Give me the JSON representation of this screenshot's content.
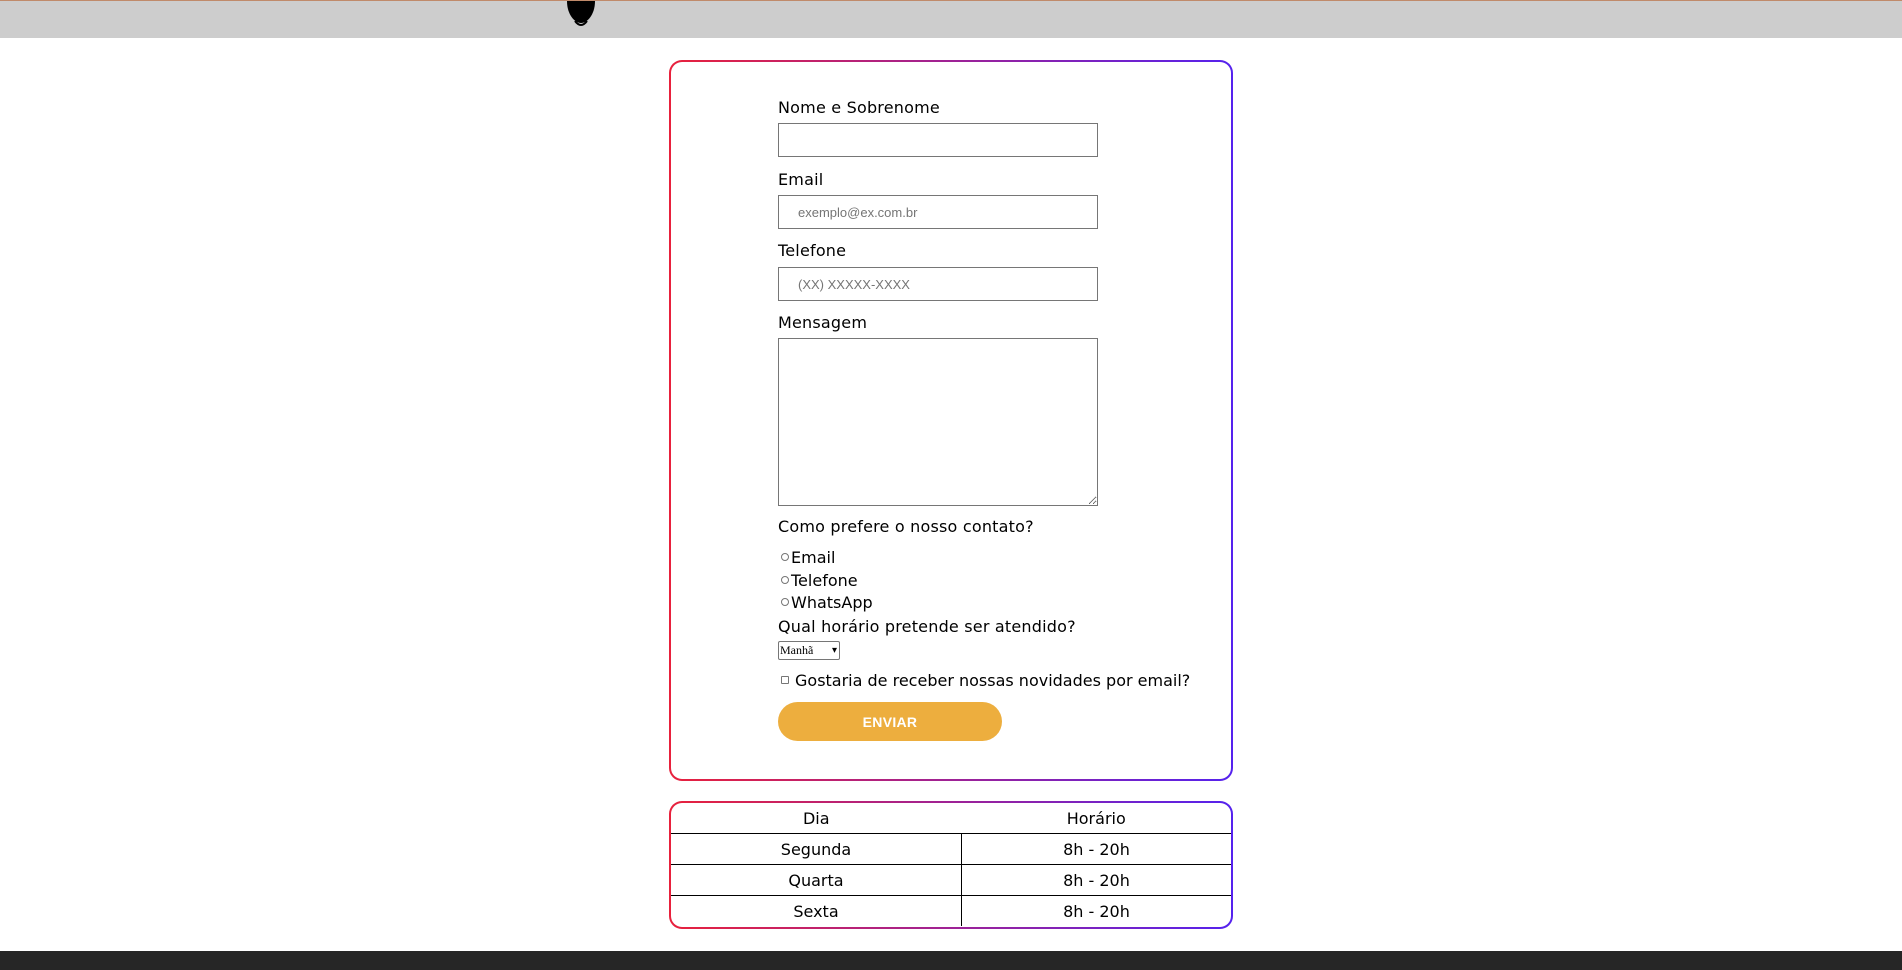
{
  "form": {
    "name_label": "Nome e Sobrenome",
    "name_value": "",
    "email_label": "Email",
    "email_placeholder": "exemplo@ex.com.br",
    "phone_label": "Telefone",
    "phone_placeholder": "(XX) XXXXX-XXXX",
    "message_label": "Mensagem",
    "contact_question": "Como prefere o nosso contato?",
    "contact_options": [
      "Email",
      "Telefone",
      "WhatsApp"
    ],
    "time_question": "Qual horário pretende ser atendido?",
    "time_selected": "Manhã",
    "newsletter_label": "Gostaria de receber nossas novidades por email?",
    "submit_label": "ENVIAR"
  },
  "hours_table": {
    "headers": [
      "Dia",
      "Horário"
    ],
    "rows": [
      [
        "Segunda",
        "8h - 20h"
      ],
      [
        "Quarta",
        "8h - 20h"
      ],
      [
        "Sexta",
        "8h - 20h"
      ]
    ]
  },
  "icons": {
    "logo": "logo-icon",
    "select_arrow": "chevron-down-icon"
  },
  "colors": {
    "topbar": "#cdcdcd",
    "accent_button": "#edae3e",
    "border_gradient_start": "#e8213c",
    "border_gradient_end": "#5522ee",
    "footer": "#262626"
  }
}
